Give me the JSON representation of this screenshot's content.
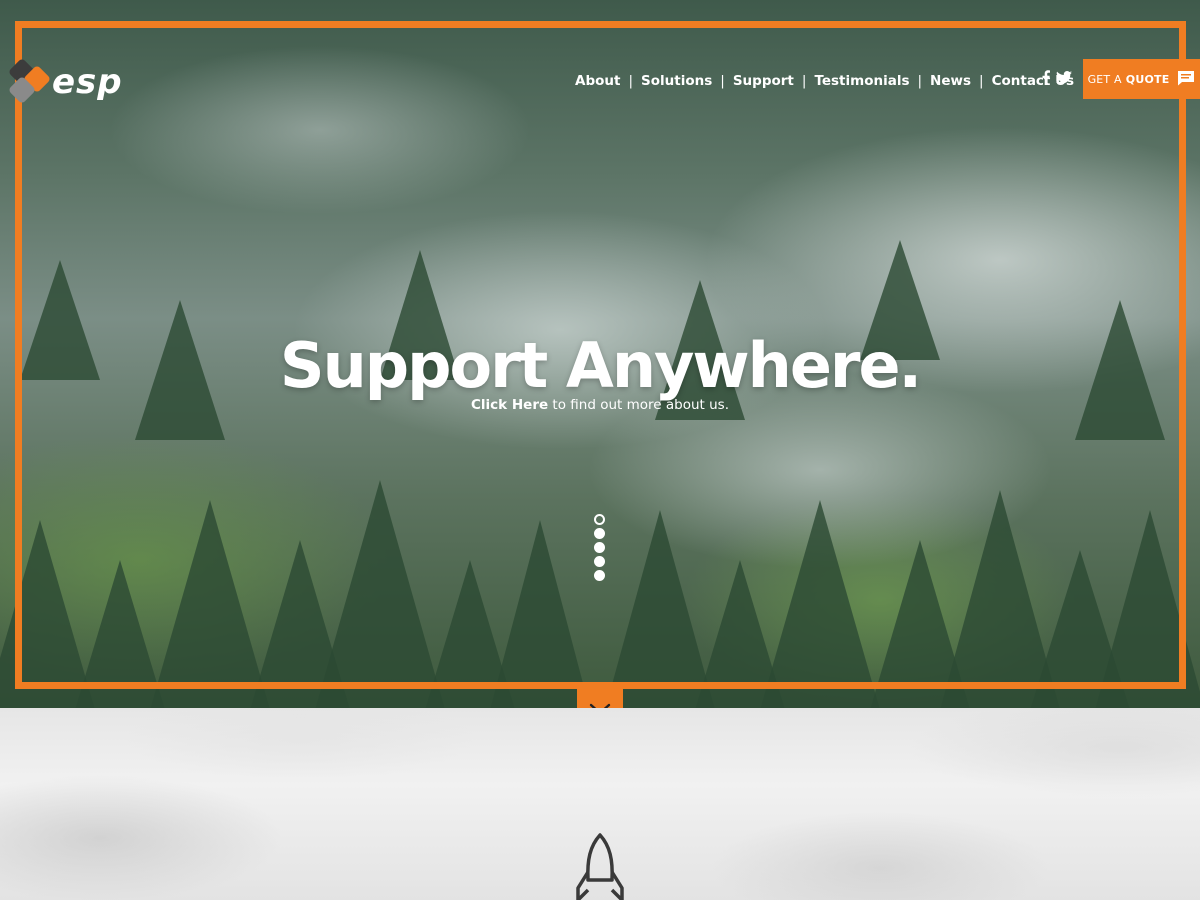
{
  "brand": {
    "logo_text": "esp",
    "accent_color": "#f07d22"
  },
  "nav": {
    "items": [
      {
        "label": "About"
      },
      {
        "label": "Solutions"
      },
      {
        "label": "Support"
      },
      {
        "label": "Testimonials"
      },
      {
        "label": "News"
      },
      {
        "label": "Contact Us"
      }
    ],
    "separator": "|"
  },
  "social": {
    "icons": [
      "facebook-icon",
      "twitter-icon"
    ]
  },
  "quote_button": {
    "prefix": "GET A",
    "bold": "QUOTE",
    "icon": "chat-icon"
  },
  "hero": {
    "headline": "Support Anywhere.",
    "cta_link": "Click Here",
    "cta_rest": " to find out more about us.",
    "slides": {
      "count": 5,
      "active": 1
    }
  },
  "scroll_button": {
    "icon": "chevron-down-icon"
  },
  "section": {
    "icon": "rocket-icon"
  }
}
